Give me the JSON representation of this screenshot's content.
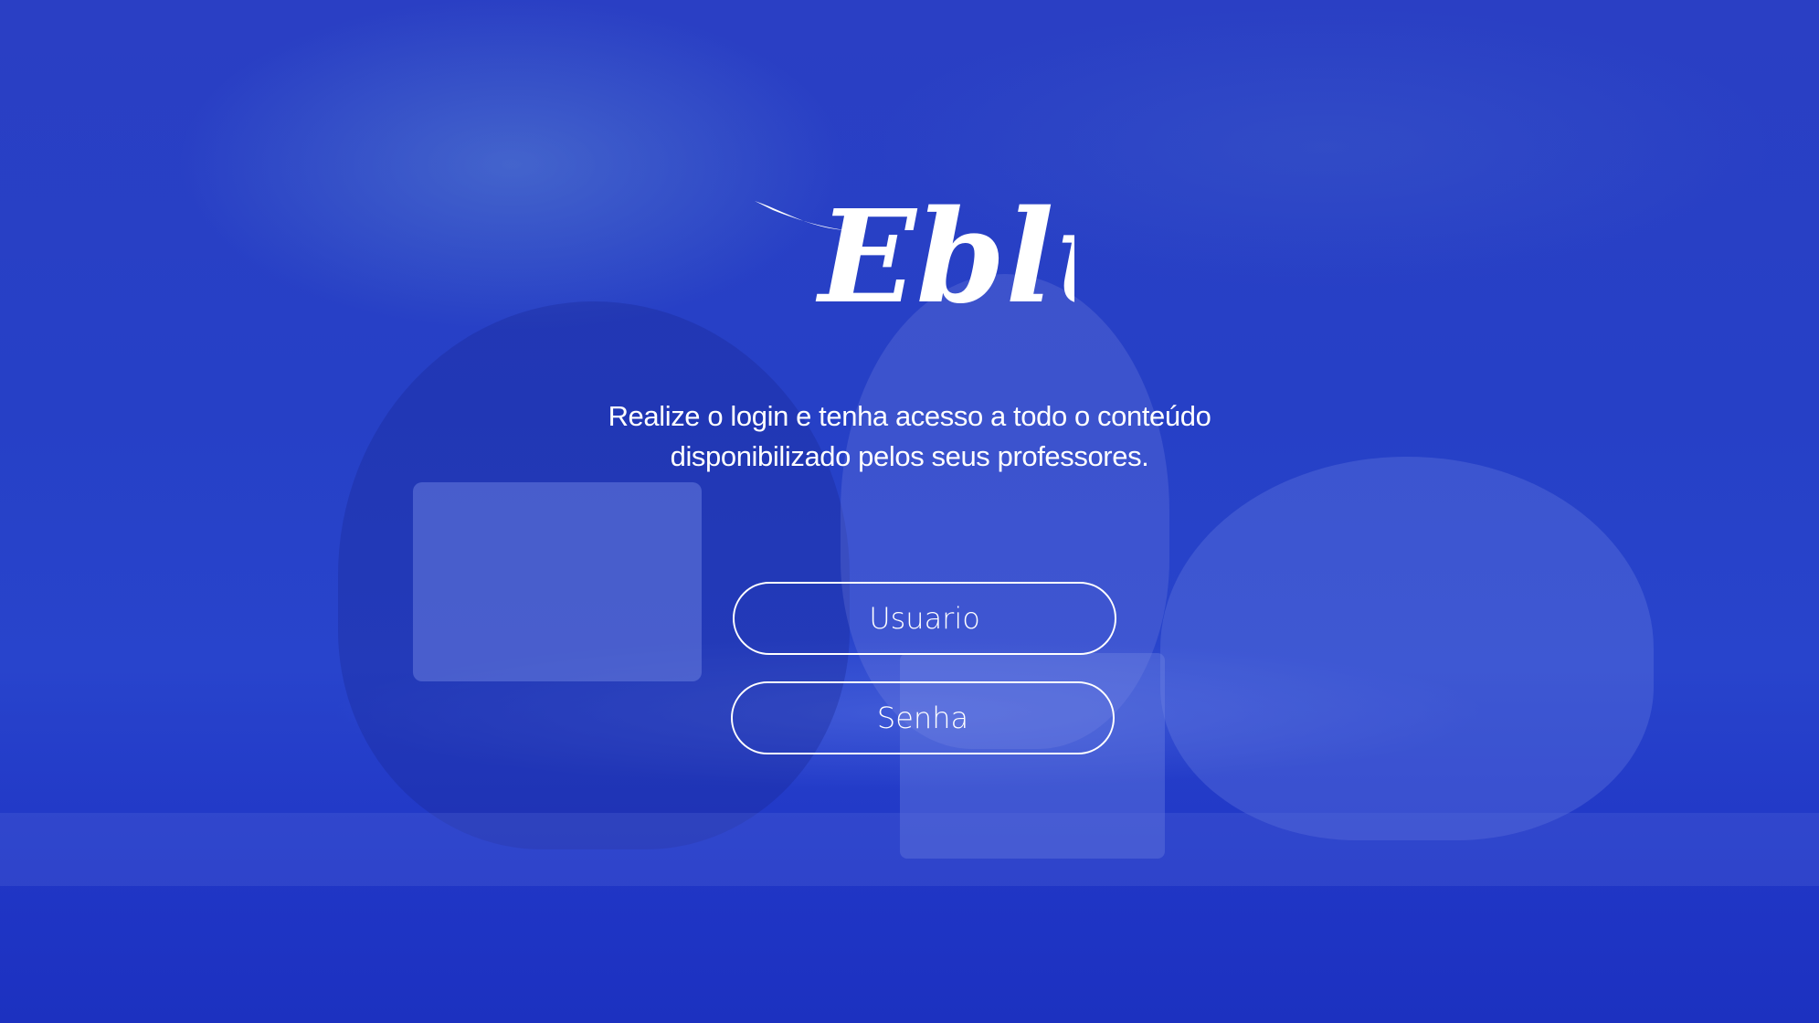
{
  "app": {
    "logo_text": "Eblue",
    "brand_color": "#1d35c4"
  },
  "login": {
    "tagline_line1": "Realize o login e tenha acesso a todo o conteúdo",
    "tagline_line2": "disponibilizado pelos seus professores.",
    "username": {
      "placeholder": "Usuario",
      "value": ""
    },
    "password": {
      "placeholder": "Senha",
      "value": ""
    }
  }
}
